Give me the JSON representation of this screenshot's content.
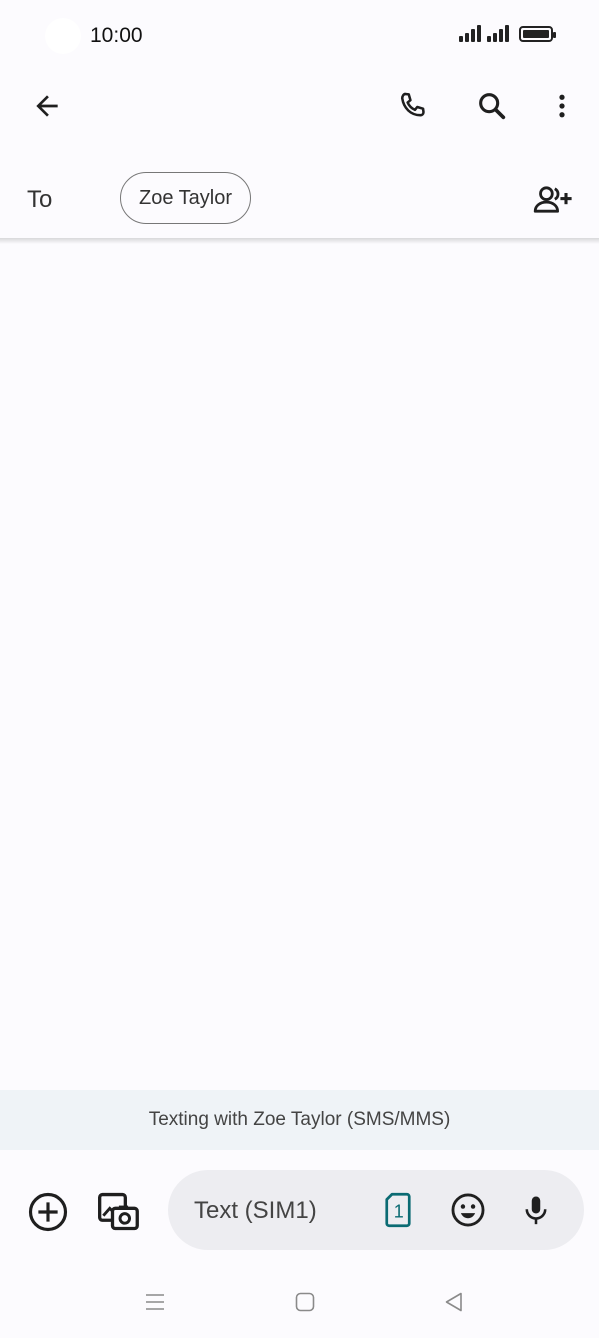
{
  "status_bar": {
    "time": "10:00"
  },
  "recipient": {
    "to_label": "To",
    "contact_name": "Zoe Taylor"
  },
  "banner": {
    "text": "Texting with Zoe Taylor (SMS/MMS)"
  },
  "compose": {
    "placeholder": "Text (SIM1)",
    "sim_number": "1"
  },
  "colors": {
    "sim_accent": "#0b6b73",
    "background": "#fcfbfe",
    "banner_bg": "#eff3f7"
  }
}
